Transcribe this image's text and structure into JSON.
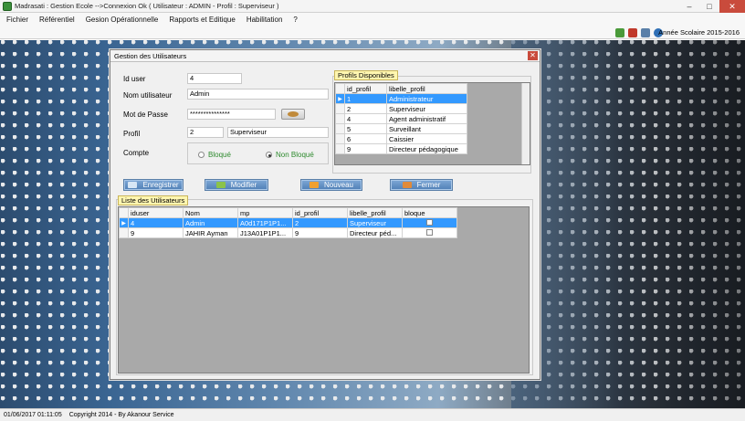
{
  "window": {
    "title": "Madrasati : Gestion Ecole -->Connexion Ok ( Utilisateur : ADMIN - Profil : Superviseur )",
    "minimize": "–",
    "maximize": "□",
    "close": "✕"
  },
  "menu": [
    "Fichier",
    "Référentiel",
    "Gesion Opérationnelle",
    "Rapports et Editique",
    "Habilitation",
    "?"
  ],
  "toolbar": {
    "icons": [
      "refresh-icon",
      "disconnect-icon",
      "home-icon",
      "help-icon"
    ],
    "school_year": "Année Scolaire 2015-2016"
  },
  "dialog": {
    "title": "Gestion des Utilisateurs",
    "close": "✕",
    "form": {
      "id_user_label": "Id user",
      "id_user_value": "4",
      "nom_label": "Nom utilisateur",
      "nom_value": "Admin",
      "mdp_label": "Mot de Passe",
      "mdp_value": "***************",
      "profil_label": "Profil",
      "profil_id": "2",
      "profil_name": "Superviseur",
      "compte_label": "Compte",
      "radio_bloque": "Bloqué",
      "radio_non_bloque": "Non Bloqué",
      "selected": "Non Bloqué"
    },
    "profils": {
      "title": "Profils Disponibles",
      "columns": [
        "id_profil",
        "libelle_profil"
      ],
      "rows": [
        [
          "1",
          "Administrateur"
        ],
        [
          "2",
          "Superviseur"
        ],
        [
          "4",
          "Agent administratif"
        ],
        [
          "5",
          "Surveillant"
        ],
        [
          "6",
          "Caissier"
        ],
        [
          "9",
          "Directeur pédagogique"
        ]
      ],
      "selected_row": 0
    },
    "buttons": {
      "save": "Enregistrer",
      "edit": "Modifier",
      "new": "Nouveau",
      "close": "Fermer"
    },
    "users": {
      "title": "Liste des Utilisateurs",
      "columns": [
        "iduser",
        "Nom",
        "mp",
        "id_profil",
        "libelle_profil",
        "bloque"
      ],
      "rows": [
        [
          "4",
          "Admin",
          "A0d171P1P1...",
          "2",
          "Superviseur",
          ""
        ],
        [
          "9",
          "JAHIR Ayman",
          "J13A01P1P1...",
          "9",
          "Directeur péd...",
          ""
        ]
      ],
      "selected_row": 0
    }
  },
  "status": {
    "datetime": "01/06/2017 01:11:05",
    "copyright": "Copyright 2014 - By Akanour Service"
  },
  "colors": {
    "selection": "#3399ff",
    "button": "#4f7fb5",
    "group_title_bg": "#fff6b0",
    "radio_text": "#2d8a2d",
    "close": "#c94b3c"
  }
}
